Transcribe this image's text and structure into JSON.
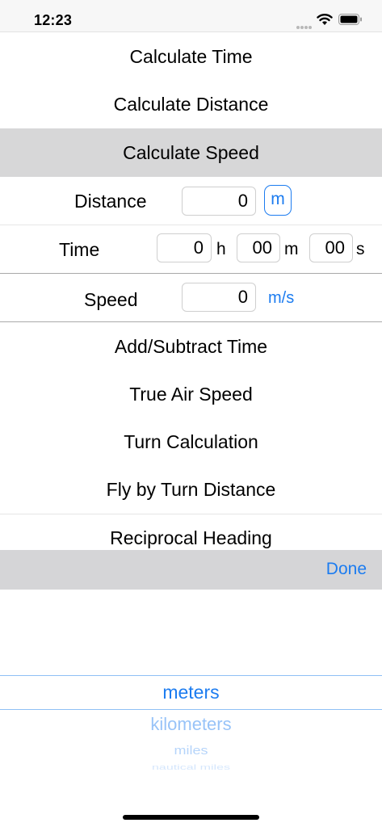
{
  "status_bar": {
    "time": "12:23",
    "icons": [
      "cellular-dots-icon",
      "wifi-icon",
      "battery-icon"
    ]
  },
  "menu": {
    "calculate_time": "Calculate Time",
    "calculate_distance": "Calculate Distance",
    "calculate_speed": "Calculate Speed",
    "add_subtract_time": "Add/Subtract Time",
    "true_air_speed": "True Air Speed",
    "turn_calculation": "Turn Calculation",
    "fly_by_turn_distance": "Fly by Turn Distance",
    "reciprocal_heading": "Reciprocal Heading"
  },
  "form": {
    "distance": {
      "label": "Distance",
      "value": "0",
      "unit": "m"
    },
    "time": {
      "label": "Time",
      "hours": "0",
      "hours_unit": "h",
      "minutes": "00",
      "minutes_unit": "m",
      "seconds": "00",
      "seconds_unit": "s"
    },
    "speed": {
      "label": "Speed",
      "value": "0",
      "unit": "m/s"
    }
  },
  "toolbar": {
    "done_label": "Done"
  },
  "picker": {
    "selected": "meters",
    "options": [
      "meters",
      "kilometers",
      "miles",
      "nautical miles"
    ]
  },
  "colors": {
    "accent": "#1c7cf0",
    "selected_row": "#d7d7d8",
    "toolbar": "#d5d5d7"
  }
}
